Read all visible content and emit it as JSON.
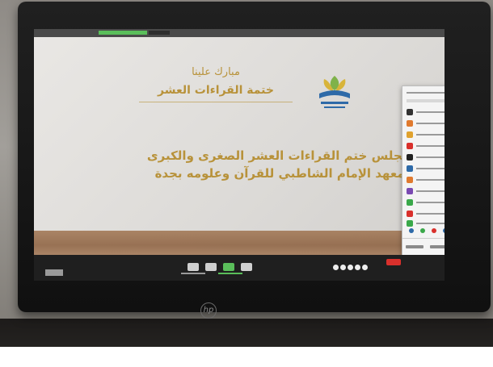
{
  "slide": {
    "title_line1": "مبارك علينا",
    "title_line2": "ختمة القراءات العشر",
    "body_line1": "مجلس ختم القراءات العشر الصغرى والكبرى",
    "body_line2": "بمعهد الإمام الشاطبي للقرآن وعلومه بجدة"
  },
  "colors": {
    "slide_text": "#b8923a",
    "end_button": "#d9302c",
    "recording_indicator": "#5abe5a"
  },
  "icons": {
    "monitor_logo": "hp-logo",
    "end_meeting": "end-meeting-button",
    "reactions": "reaction-icons"
  },
  "monitor": {
    "logo_text": "hp"
  }
}
